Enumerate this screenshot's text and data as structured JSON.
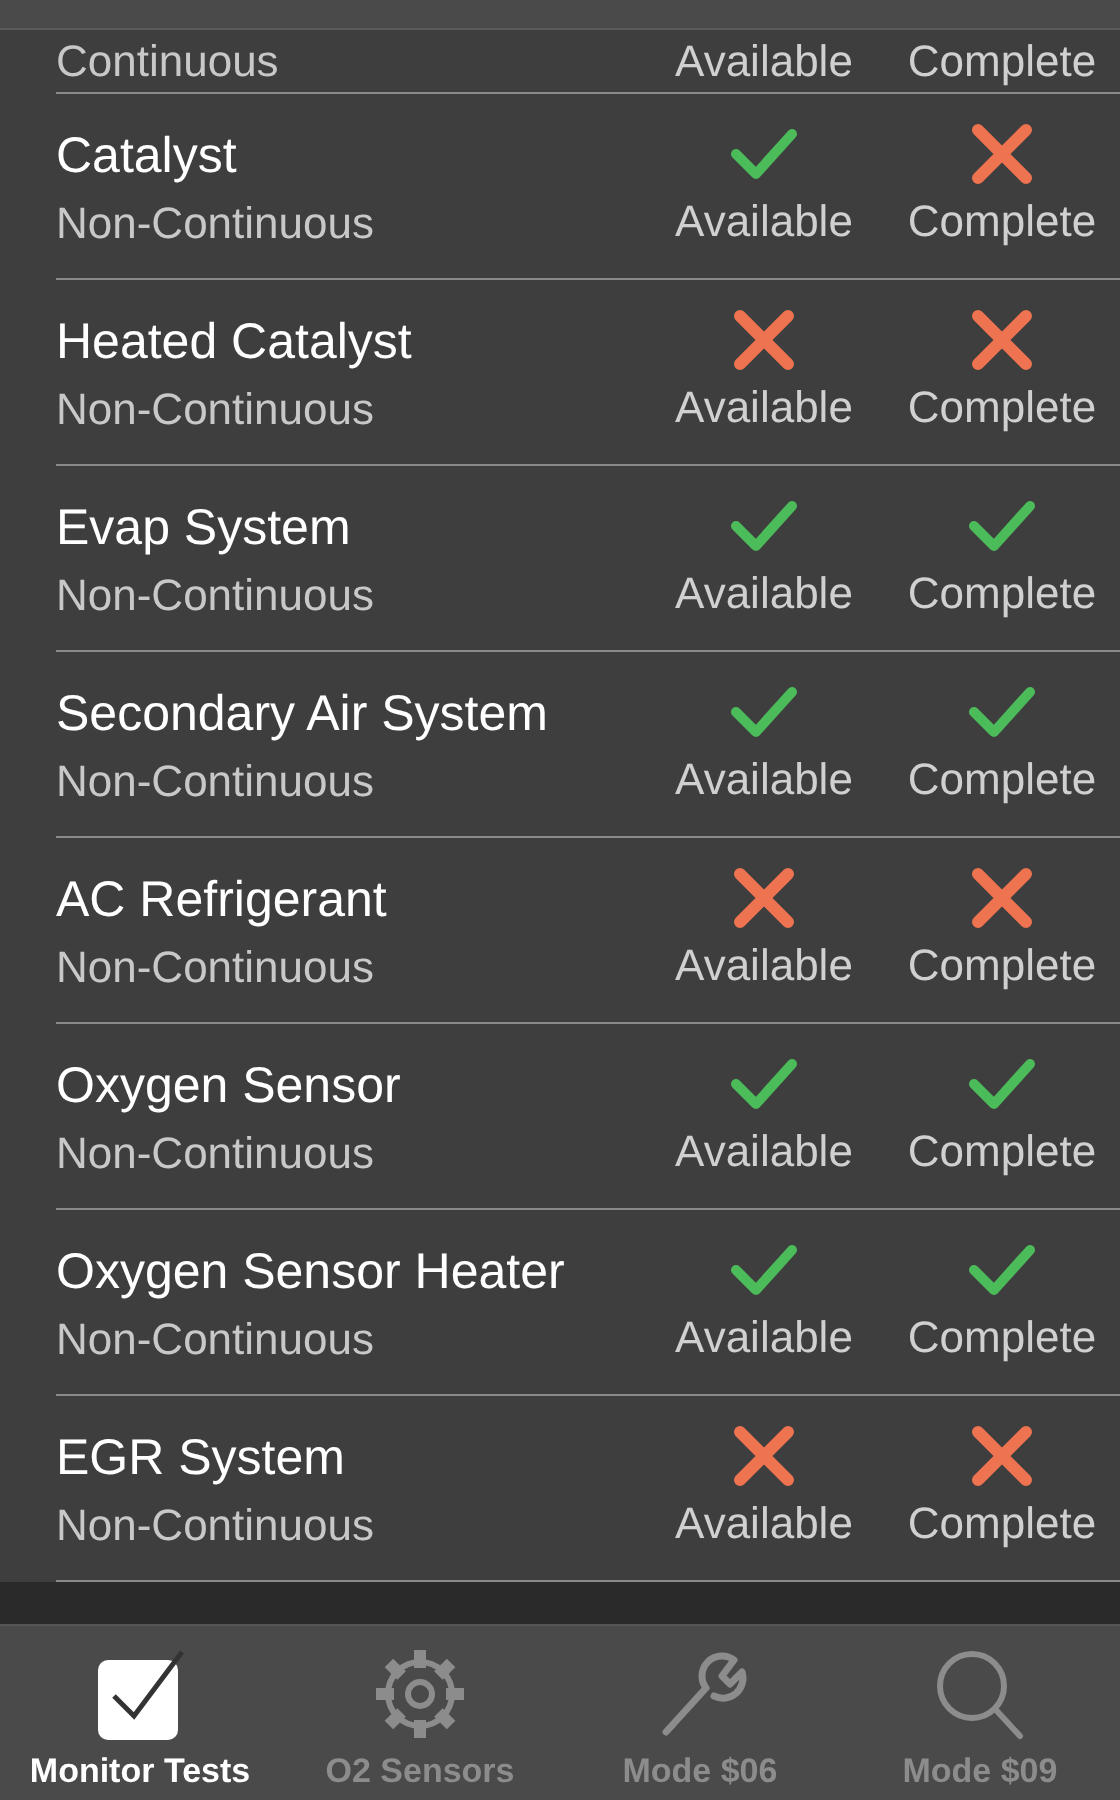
{
  "monitors": [
    {
      "type": "Continuous",
      "available_label": "Available",
      "complete_label": "Complete"
    },
    {
      "name": "Catalyst",
      "type": "Non-Continuous",
      "available": true,
      "complete": false,
      "available_label": "Available",
      "complete_label": "Complete"
    },
    {
      "name": "Heated Catalyst",
      "type": "Non-Continuous",
      "available": false,
      "complete": false,
      "available_label": "Available",
      "complete_label": "Complete"
    },
    {
      "name": "Evap System",
      "type": "Non-Continuous",
      "available": true,
      "complete": true,
      "available_label": "Available",
      "complete_label": "Complete"
    },
    {
      "name": "Secondary Air System",
      "type": "Non-Continuous",
      "available": true,
      "complete": true,
      "available_label": "Available",
      "complete_label": "Complete"
    },
    {
      "name": "AC Refrigerant",
      "type": "Non-Continuous",
      "available": false,
      "complete": false,
      "available_label": "Available",
      "complete_label": "Complete"
    },
    {
      "name": "Oxygen Sensor",
      "type": "Non-Continuous",
      "available": true,
      "complete": true,
      "available_label": "Available",
      "complete_label": "Complete"
    },
    {
      "name": "Oxygen Sensor Heater",
      "type": "Non-Continuous",
      "available": true,
      "complete": true,
      "available_label": "Available",
      "complete_label": "Complete"
    },
    {
      "name": "EGR System",
      "type": "Non-Continuous",
      "available": false,
      "complete": false,
      "available_label": "Available",
      "complete_label": "Complete"
    }
  ],
  "tabs": [
    {
      "label": "Monitor Tests",
      "kind": "check",
      "selected": true
    },
    {
      "label": "O2 Sensors",
      "kind": "gear",
      "selected": false
    },
    {
      "label": "Mode $06",
      "kind": "wrench",
      "selected": false
    },
    {
      "label": "Mode $09",
      "kind": "search",
      "selected": false
    }
  ]
}
